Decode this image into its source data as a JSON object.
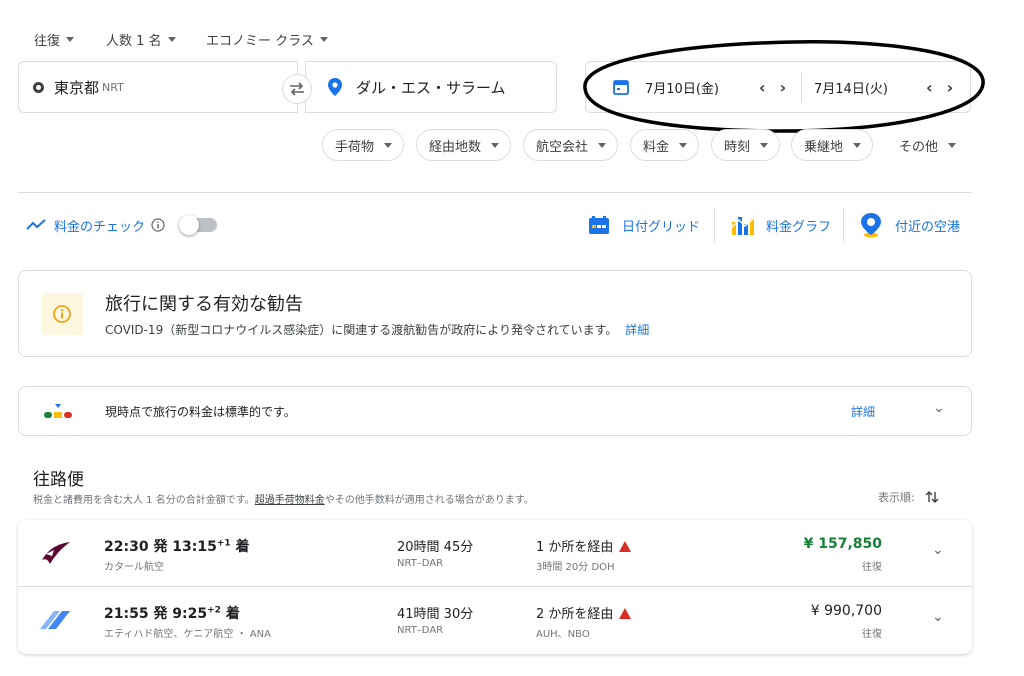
{
  "top_options": {
    "trip_type": "往復",
    "passengers": "人数 1 名",
    "cabin_class": "エコノミー クラス"
  },
  "search": {
    "origin_city": "東京都",
    "origin_code": "NRT",
    "destination": "ダル・エス・サラーム",
    "depart_date": "7月10日(金)",
    "return_date": "7月14日(火)"
  },
  "filters": [
    "手荷物",
    "経由地数",
    "航空会社",
    "料金",
    "時刻",
    "乗継地"
  ],
  "filters_more": "その他",
  "tools": {
    "price_tracking": "料金のチェック",
    "date_grid": "日付グリッド",
    "price_graph": "料金グラフ",
    "nearby_airports": "付近の空港"
  },
  "advisory": {
    "title": "旅行に関する有効な勧告",
    "body": "COVID-19（新型コロナウイルス感染症）に関連する渡航勧告が政府により発令されています。",
    "link": "詳細"
  },
  "insight": {
    "text": "現時点で旅行の料金は標準的です。",
    "link": "詳細"
  },
  "outbound": {
    "title": "往路便",
    "subtitle_pre": "税金と諸費用を含む大人 1 名分の合計金額です。",
    "subtitle_link": "超過手荷物料金",
    "subtitle_post": "やその他手数料が適用される場合があります。",
    "sort_label": "表示順:"
  },
  "flights": [
    {
      "depart": "22:30 発 13:15",
      "offset": "+1",
      "arrive_suffix": " 着",
      "airline": "カタール航空",
      "duration": "20時間 45分",
      "route": "NRT–DAR",
      "stops": "1 か所を経由",
      "layover": "3時間 20分 DOH",
      "price": "¥ 157,850",
      "price_type": "往復",
      "price_color": "#188038"
    },
    {
      "depart": "21:55 発 9:25",
      "offset": "+2",
      "arrive_suffix": " 着",
      "airline": "エティハド航空、ケニア航空 ・ ANA",
      "duration": "41時間 30分",
      "route": "NRT–DAR",
      "stops": "2 か所を経由",
      "layover": "AUH、NBO",
      "price": "¥ 990,700",
      "price_type": "往復",
      "price_color": "#202124"
    }
  ],
  "colors": {
    "accent": "#1a73e8",
    "good_price": "#188038",
    "warning": "#d93025",
    "advisory_icon": "#f29900"
  }
}
